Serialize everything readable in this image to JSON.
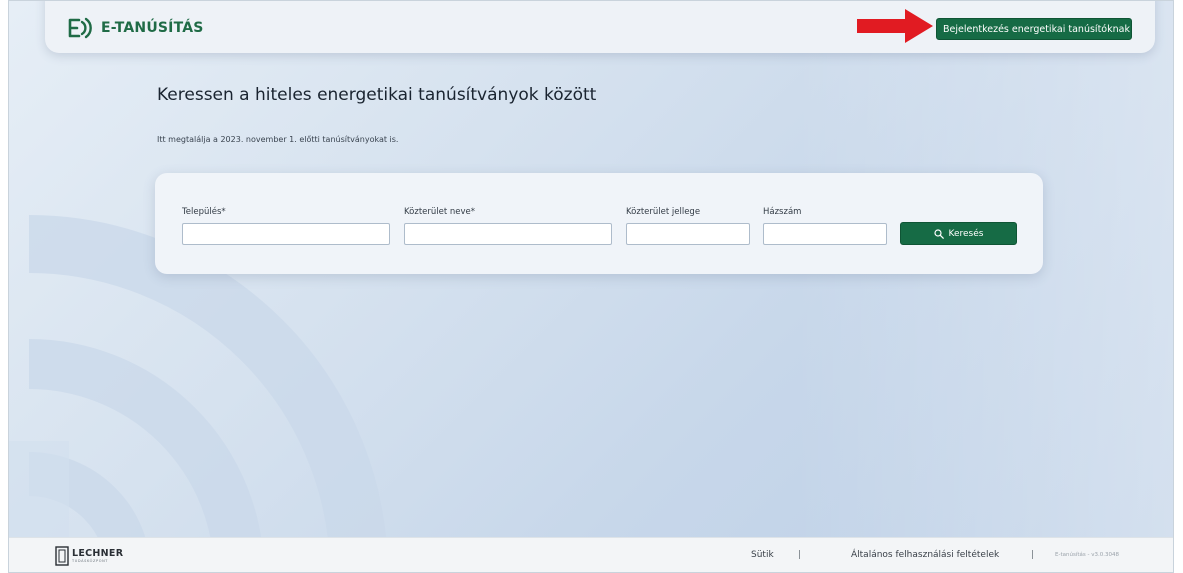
{
  "header": {
    "logo_text": "E-TANÚSÍTÁS",
    "login_button": "Bejelentkezés energetikai tanúsítóknak"
  },
  "main": {
    "title": "Keressen a hiteles energetikai tanúsítványok között",
    "subtitle": "Itt megtalálja a 2023. november 1. előtti tanúsítványokat is."
  },
  "search": {
    "fields": [
      {
        "label": "Település*",
        "value": ""
      },
      {
        "label": "Közterület neve*",
        "value": ""
      },
      {
        "label": "Közterület jellege",
        "value": ""
      },
      {
        "label": "Házszám",
        "value": ""
      }
    ],
    "button_label": "Keresés"
  },
  "footer": {
    "logo_name": "LECHNER",
    "logo_subtitle": "TUDÁSKÖZPONT",
    "links": [
      "Sütik",
      "Általános felhasználási feltételek"
    ],
    "separator": "|",
    "version": "E-tanúsítás - v3.0.3048"
  },
  "colors": {
    "brand_green": "#166b45",
    "arrow_red": "#e11b22"
  }
}
